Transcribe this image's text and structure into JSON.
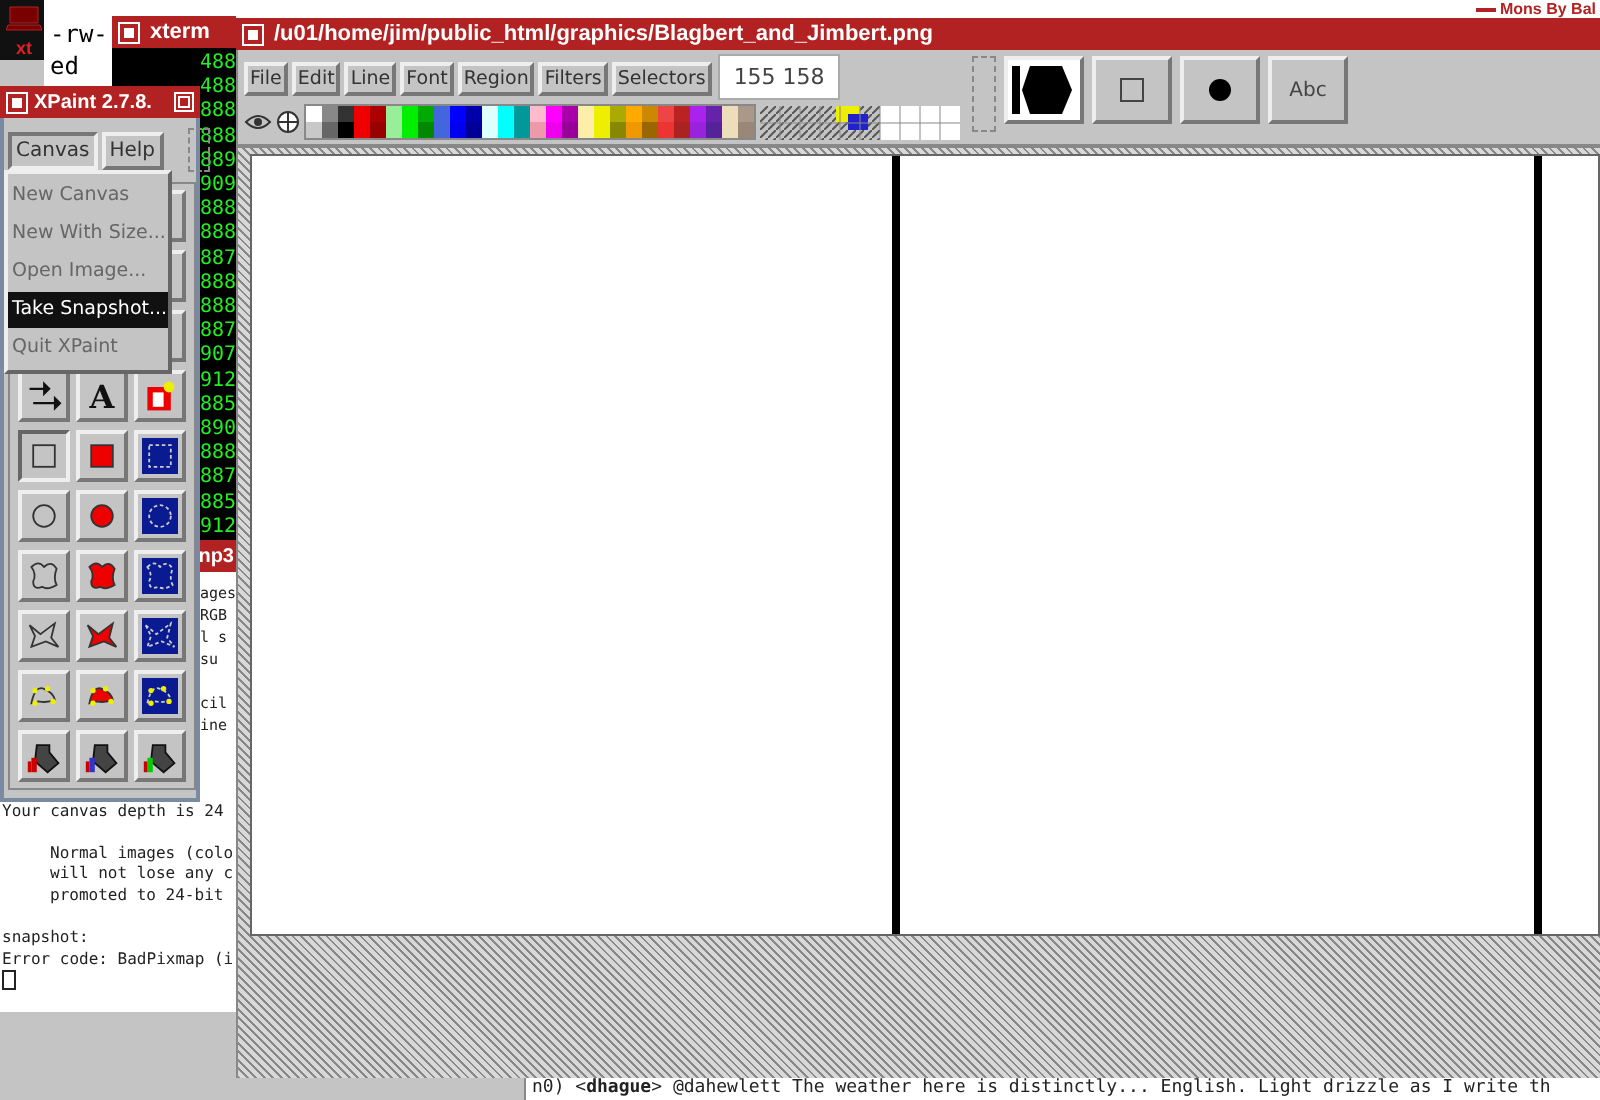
{
  "desktop_text": "Mons By Bal",
  "icon_window": {
    "label": "xt"
  },
  "terminal_fragment": {
    "lines": [
      "-rw-",
      "ed"
    ]
  },
  "xterm": {
    "title": "xterm",
    "lines": [
      "488",
      "488",
      "888",
      "888",
      "889",
      "909",
      "888",
      "888",
      "887",
      "888",
      "888",
      "887",
      "907",
      "912",
      "885",
      "890",
      "888",
      "887",
      "885",
      "912"
    ]
  },
  "terminal": {
    "title": "np3",
    "fragments_top": [
      "ages",
      "RGB",
      "l s",
      "su"
    ],
    "fragments_bottom": [
      "cil",
      "ine"
    ],
    "message": "Your canvas depth is 24",
    "indented_lines": [
      "Normal images (colo",
      "will not lose any c",
      "promoted to 24-bit"
    ],
    "output_lines": [
      "snapshot:",
      "Error code: BadPixmap (i"
    ]
  },
  "xpaint": {
    "title": "XPaint 2.7.8.",
    "menus": [
      {
        "label": "Canvas",
        "selected": true
      },
      {
        "label": "Help",
        "selected": false
      }
    ],
    "menu_items": [
      {
        "label": "New Canvas",
        "selected": false
      },
      {
        "label": "New With Size...",
        "selected": false
      },
      {
        "label": "Open Image...",
        "selected": false
      },
      {
        "label": "Take Snapshot...",
        "selected": true
      },
      {
        "label": "Quit XPaint",
        "selected": false
      }
    ],
    "tools": [
      {
        "kind": "select",
        "selected": false
      },
      {
        "kind": "text",
        "label": "A",
        "selected": false
      },
      {
        "kind": "fill",
        "selected": false
      },
      {
        "kind": "rect",
        "selected": true
      },
      {
        "kind": "filled-rect",
        "selected": false
      },
      {
        "kind": "region-rect",
        "selected": false
      },
      {
        "kind": "circle",
        "selected": false
      },
      {
        "kind": "filled-circle",
        "selected": false
      },
      {
        "kind": "region-circle",
        "selected": false
      },
      {
        "kind": "freehand",
        "selected": false
      },
      {
        "kind": "filled-freehand",
        "selected": false
      },
      {
        "kind": "region-freehand",
        "selected": false
      },
      {
        "kind": "polygon",
        "selected": false
      },
      {
        "kind": "filled-polygon",
        "selected": false
      },
      {
        "kind": "region-polygon",
        "selected": false
      },
      {
        "kind": "spline",
        "selected": false
      },
      {
        "kind": "filled-spline",
        "selected": false
      },
      {
        "kind": "region-spline",
        "selected": false
      },
      {
        "kind": "spray",
        "selected": false
      },
      {
        "kind": "spray-color",
        "selected": false
      },
      {
        "kind": "spray-rainbow",
        "selected": false
      }
    ]
  },
  "editor": {
    "title": "/u01/home/jim/public_html/graphics/Blagbert_and_Jimbert.png",
    "menus": [
      "File",
      "Edit",
      "Line",
      "Font",
      "Region",
      "Filters",
      "Selectors"
    ],
    "coordinates": "155 158",
    "palette": [
      {
        "color": "#ffffff"
      },
      {
        "color": "#c8c8c8"
      },
      {
        "color": "#888888"
      },
      {
        "color": "#666666"
      },
      {
        "color": "#333333"
      },
      {
        "color": "#000000"
      },
      {
        "color": "#ee0000"
      },
      {
        "color": "#ee0000"
      },
      {
        "color": "#aa0000"
      },
      {
        "color": "#990000"
      },
      {
        "color": "#99ee99"
      },
      {
        "color": "#99ee99"
      },
      {
        "color": "#00ee00"
      },
      {
        "color": "#00ee00"
      },
      {
        "color": "#00aa00"
      },
      {
        "color": "#008800"
      },
      {
        "color": "#4466dd"
      },
      {
        "color": "#4466dd"
      },
      {
        "color": "#0000ff"
      },
      {
        "color": "#0000ee"
      },
      {
        "color": "#0000aa"
      },
      {
        "color": "#000099"
      },
      {
        "color": "#ddffff"
      },
      {
        "color": "#ddffff"
      },
      {
        "color": "#00ffff"
      },
      {
        "color": "#00ffff"
      },
      {
        "color": "#009999"
      },
      {
        "color": "#009999"
      },
      {
        "color": "#ffbbcc"
      },
      {
        "color": "#ee99aa"
      },
      {
        "color": "#ff00ff"
      },
      {
        "color": "#ee00ee"
      },
      {
        "color": "#aa00aa"
      },
      {
        "color": "#990099"
      },
      {
        "color": "#ffeeaa"
      },
      {
        "color": "#ffeeaa"
      },
      {
        "color": "#eeee00"
      },
      {
        "color": "#eeee00"
      },
      {
        "color": "#aaaa00"
      },
      {
        "color": "#888800"
      },
      {
        "color": "#ffaa00"
      },
      {
        "color": "#ee9900"
      },
      {
        "color": "#cc8800"
      },
      {
        "color": "#996600"
      },
      {
        "color": "#ee4444"
      },
      {
        "color": "#ee3333"
      },
      {
        "color": "#bb2222"
      },
      {
        "color": "#aa2222"
      },
      {
        "color": "#aa22ee"
      },
      {
        "color": "#9922dd"
      },
      {
        "color": "#6622aa"
      },
      {
        "color": "#552299"
      },
      {
        "color": "#eeddbb"
      },
      {
        "color": "#eeddbb"
      },
      {
        "color": "#aa9988"
      },
      {
        "color": "#998877"
      }
    ],
    "brushes": [
      {
        "kind": "hexagon",
        "selected": true
      },
      {
        "kind": "square",
        "selected": false
      },
      {
        "kind": "dot",
        "selected": false
      },
      {
        "kind": "font",
        "label": "Abc",
        "selected": false
      }
    ]
  },
  "chat_line": "n0) <**dhague**> @dahewlett The weather here is distinctly... English. Light drizzle as I write th"
}
